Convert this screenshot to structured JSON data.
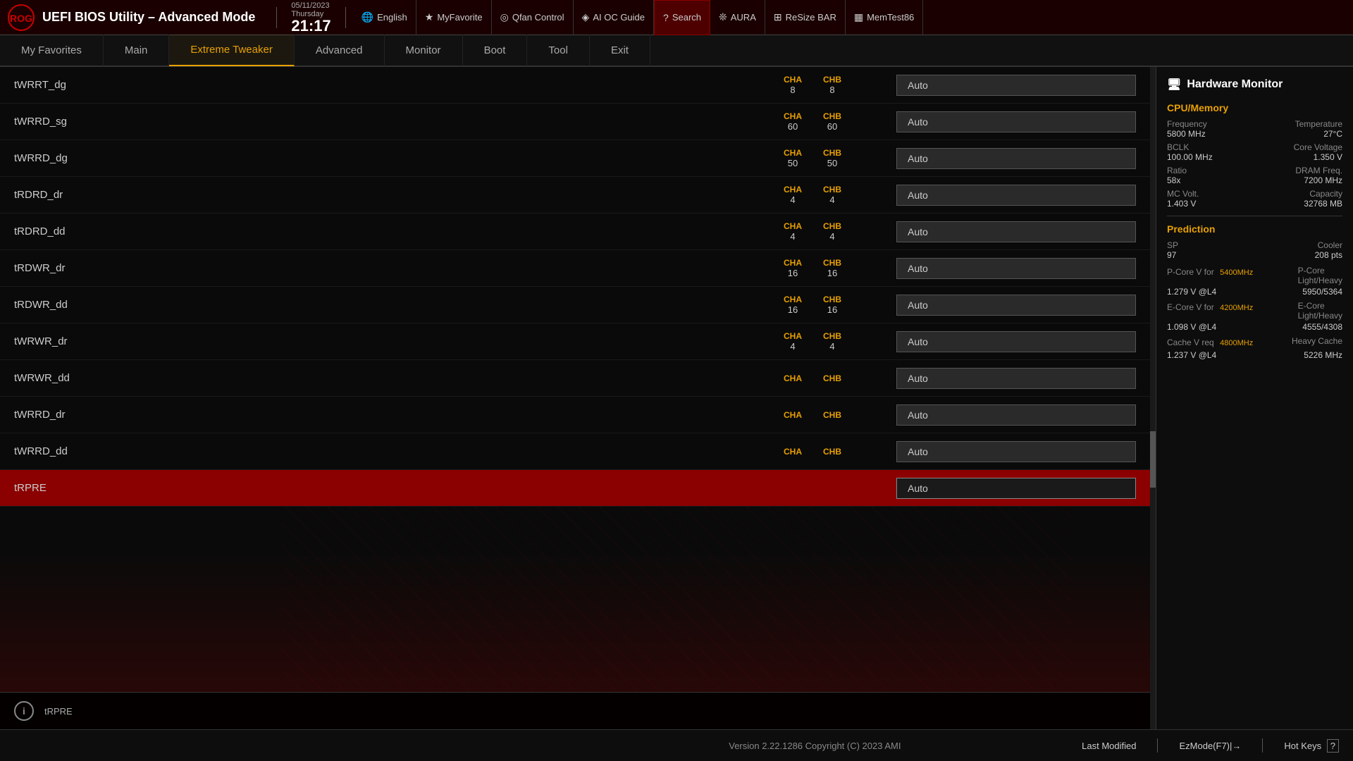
{
  "header": {
    "title": "UEFI BIOS Utility – Advanced Mode",
    "datetime": {
      "date": "05/11/2023",
      "day": "Thursday",
      "time": "21:17"
    },
    "toolbar_items": [
      {
        "id": "settings",
        "icon": "⚙",
        "label": null
      },
      {
        "id": "english",
        "icon": "🌐",
        "label": "English"
      },
      {
        "id": "myfavorite",
        "icon": "★",
        "label": "MyFavorite"
      },
      {
        "id": "qfan",
        "icon": "◎",
        "label": "Qfan Control"
      },
      {
        "id": "aioc",
        "icon": "◈",
        "label": "AI OC Guide"
      },
      {
        "id": "search",
        "icon": "?",
        "label": "Search"
      },
      {
        "id": "aura",
        "icon": "❊",
        "label": "AURA"
      },
      {
        "id": "resize",
        "icon": "⊞",
        "label": "ReSize BAR"
      },
      {
        "id": "memtest",
        "icon": "▦",
        "label": "MemTest86"
      }
    ]
  },
  "nav": {
    "items": [
      {
        "id": "favorites",
        "label": "My Favorites",
        "active": false
      },
      {
        "id": "main",
        "label": "Main",
        "active": false
      },
      {
        "id": "extreme",
        "label": "Extreme Tweaker",
        "active": true
      },
      {
        "id": "advanced",
        "label": "Advanced",
        "active": false
      },
      {
        "id": "monitor",
        "label": "Monitor",
        "active": false
      },
      {
        "id": "boot",
        "label": "Boot",
        "active": false
      },
      {
        "id": "tool",
        "label": "Tool",
        "active": false
      },
      {
        "id": "exit",
        "label": "Exit",
        "active": false
      }
    ]
  },
  "settings": {
    "rows": [
      {
        "id": "twrrt_dg_top",
        "name": "tWRRT_dg",
        "cha": "8",
        "chb": "8",
        "value": "Auto",
        "selected": false
      },
      {
        "id": "twrrd_sg",
        "name": "tWRRD_sg",
        "cha": "60",
        "chb": "60",
        "value": "Auto",
        "selected": false
      },
      {
        "id": "twrrd_dg",
        "name": "tWRRD_dg",
        "cha": "50",
        "chb": "50",
        "value": "Auto",
        "selected": false
      },
      {
        "id": "trdrd_dr",
        "name": "tRDRD_dr",
        "cha": "4",
        "chb": "4",
        "value": "Auto",
        "selected": false
      },
      {
        "id": "trdrd_dd",
        "name": "tRDRD_dd",
        "cha": "4",
        "chb": "4",
        "value": "Auto",
        "selected": false
      },
      {
        "id": "trdwr_dr",
        "name": "tRDWR_dr",
        "cha": "16",
        "chb": "16",
        "value": "Auto",
        "selected": false
      },
      {
        "id": "trdwr_dd",
        "name": "tRDWR_dd",
        "cha": "16",
        "chb": "16",
        "value": "Auto",
        "selected": false
      },
      {
        "id": "twrwr_dr",
        "name": "tWRWR_dr",
        "cha": "4",
        "chb": "4",
        "value": "Auto",
        "selected": false
      },
      {
        "id": "twrwr_dd",
        "name": "tWRWR_dd",
        "cha": "",
        "chb": "",
        "value": "Auto",
        "selected": false
      },
      {
        "id": "twrrd_dr",
        "name": "tWRRD_dr",
        "cha": "",
        "chb": "",
        "value": "Auto",
        "selected": false
      },
      {
        "id": "twrrd_dd",
        "name": "tWRRD_dd",
        "cha": "",
        "chb": "",
        "value": "Auto",
        "selected": false
      },
      {
        "id": "trpre",
        "name": "tRPRE",
        "cha": "",
        "chb": "",
        "value": "Auto",
        "selected": true
      }
    ],
    "cha_label": "CHA",
    "chb_label": "CHB"
  },
  "info_panel": {
    "icon": "i",
    "text": "tRPRE"
  },
  "hw_monitor": {
    "title": "Hardware Monitor",
    "section_cpu": "CPU/Memory",
    "frequency_label": "Frequency",
    "frequency_value": "5800 MHz",
    "temperature_label": "Temperature",
    "temperature_value": "27°C",
    "bclk_label": "BCLK",
    "bclk_value": "100.00 MHz",
    "core_voltage_label": "Core Voltage",
    "core_voltage_value": "1.350 V",
    "ratio_label": "Ratio",
    "ratio_value": "58x",
    "dram_freq_label": "DRAM Freq.",
    "dram_freq_value": "7200 MHz",
    "mc_volt_label": "MC Volt.",
    "mc_volt_value": "1.403 V",
    "capacity_label": "Capacity",
    "capacity_value": "32768 MB",
    "section_prediction": "Prediction",
    "sp_label": "SP",
    "sp_value": "97",
    "cooler_label": "Cooler",
    "cooler_value": "208 pts",
    "pcore_v_label": "P-Core V for",
    "pcore_v_freq": "5400MHz",
    "pcore_v_l4": "1.279 V @L4",
    "pcore_lh_label": "P-Core\nLight/Heavy",
    "pcore_lh_value": "5950/5364",
    "ecore_v_label": "E-Core V for",
    "ecore_v_freq": "4200MHz",
    "ecore_v_l4": "1.098 V @L4",
    "ecore_lh_label": "E-Core\nLight/Heavy",
    "ecore_lh_value": "4555/4308",
    "cache_v_label": "Cache V req",
    "cache_v_freq": "4800MHz",
    "cache_v_l4": "1.237 V @L4",
    "heavy_cache_label": "Heavy Cache",
    "heavy_cache_value": "5226 MHz"
  },
  "bottom": {
    "version": "Version 2.22.1286 Copyright (C) 2023 AMI",
    "last_modified": "Last Modified",
    "ez_mode": "EzMode(F7)|→",
    "hot_keys": "Hot Keys",
    "hot_keys_icon": "?"
  }
}
